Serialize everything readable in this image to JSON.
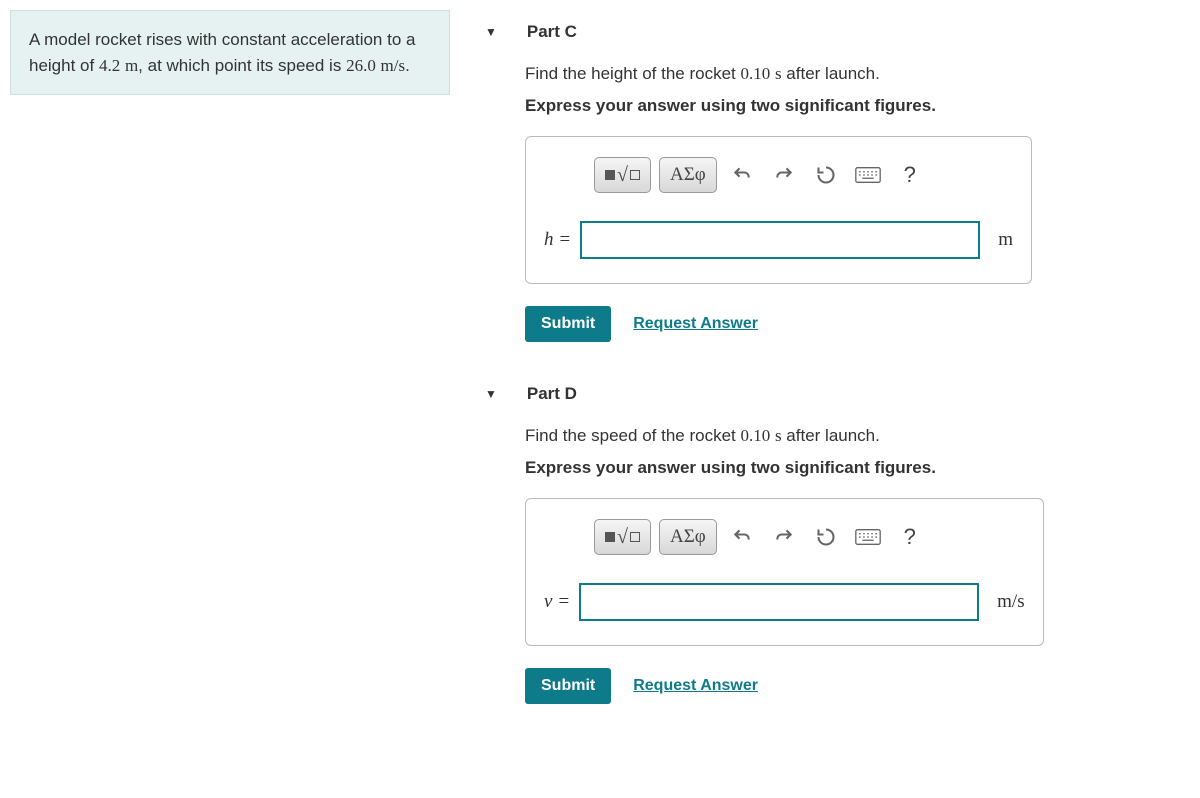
{
  "problem": {
    "text_prefix": "A model rocket rises with constant acceleration to a height of ",
    "height": "4.2",
    "height_unit": "m",
    "text_mid": ", at which point its speed is ",
    "speed": "26.0",
    "speed_unit": "m/s",
    "text_suffix": "."
  },
  "parts": {
    "c": {
      "title": "Part C",
      "prompt_prefix": "Find the height of the rocket ",
      "time": "0.10",
      "time_unit": "s",
      "prompt_suffix": " after launch.",
      "instruction": "Express your answer using two significant figures.",
      "variable": "h",
      "equals": "=",
      "unit": "m",
      "input_value": "",
      "submit_label": "Submit",
      "request_label": "Request Answer"
    },
    "d": {
      "title": "Part D",
      "prompt_prefix": "Find the speed of the rocket ",
      "time": "0.10",
      "time_unit": "s",
      "prompt_suffix": " after launch.",
      "instruction": "Express your answer using two significant figures.",
      "variable": "v",
      "equals": "=",
      "unit": "m/s",
      "input_value": "",
      "submit_label": "Submit",
      "request_label": "Request Answer"
    }
  },
  "toolbar": {
    "greek_label": "ΑΣφ",
    "help_label": "?"
  }
}
